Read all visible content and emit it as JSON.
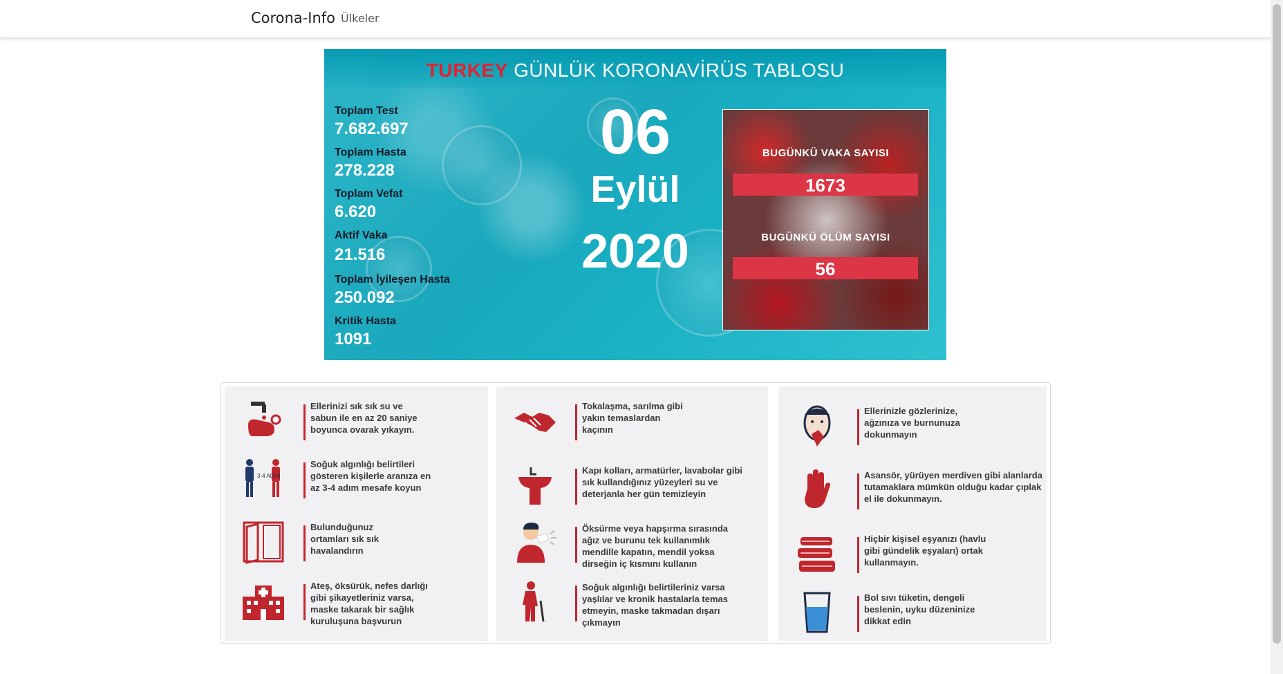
{
  "navbar": {
    "brand": "Corona-Info",
    "link_countries": "Ülkeler"
  },
  "banner": {
    "title_country": "TURKEY",
    "title_rest": "GÜNLÜK KORONAVİRÜS TABLOSU",
    "stats": [
      {
        "label": "Toplam Test",
        "value": "7.682.697"
      },
      {
        "label": "Toplam Hasta",
        "value": "278.228"
      },
      {
        "label": "Toplam Vefat",
        "value": "6.620"
      },
      {
        "label": "Aktif Vaka",
        "value": "21.516"
      },
      {
        "label": "Toplam İyileşen Hasta",
        "value": "250.092"
      },
      {
        "label": "Kritik Hasta",
        "value": "1091"
      }
    ],
    "date": {
      "day": "06",
      "month": "Eylül",
      "year": "2020"
    },
    "today": {
      "cases_label": "BUGÜNKÜ VAKA SAYISI",
      "cases_value": "1673",
      "deaths_label": "BUGÜNKÜ ÖLÜM SAYISI",
      "deaths_value": "56"
    }
  },
  "precautions": {
    "columns": [
      [
        {
          "icon": "handwash-icon",
          "text": "Ellerinizi sık sık su ve sabun ile en az 20 saniye boyunca ovarak yıkayın."
        },
        {
          "icon": "distance-icon",
          "text": "Soğuk algınlığı belirtileri gösteren kişilerle aranıza en az 3-4 adım mesafe koyun",
          "icon_text": "3-4 ADIM"
        },
        {
          "icon": "window-icon",
          "text": "Bulunduğunuz ortamları sık sık havalandırın"
        },
        {
          "icon": "hospital-icon",
          "text": "Ateş, öksürük, nefes darlığı gibi şikayetleriniz varsa, maske takarak bir sağlık kuruluşuna başvurun"
        }
      ],
      [
        {
          "icon": "handshake-icon",
          "text": "Tokalaşma, sarılma gibi yakın temaslardan kaçının"
        },
        {
          "icon": "sink-icon",
          "text": "Kapı kolları, armatürler, lavabolar gibi sık kullandığınız yüzeyleri su ve deterjanla her gün temizleyin"
        },
        {
          "icon": "cough-icon",
          "text": "Öksürme veya hapşırma sırasında ağız ve burunu tek kullanımlık mendille kapatın, mendil yoksa dirseğin iç kısmını kullanın"
        },
        {
          "icon": "elderly-icon",
          "text": "Soğuk algınlığı belirtileriniz varsa yaşlılar ve kronik hastalarla temas etmeyin, maske takmadan dışarı çıkmayın"
        }
      ],
      [
        {
          "icon": "face-touch-icon",
          "text": "Ellerinizle gözlerinize, ağzınıza ve burnunuza dokunmayın"
        },
        {
          "icon": "hand-stop-icon",
          "text": "Asansör, yürüyen merdiven gibi alanlarda tutamaklara mümkün olduğu kadar çıplak el ile dokunmayın."
        },
        {
          "icon": "towels-icon",
          "text": "Hiçbir kişisel eşyanızı (havlu gibi gündelik eşyaları) ortak kullanmayın."
        },
        {
          "icon": "water-glass-icon",
          "text": "Bol sıvı tüketin, dengeli beslenin, uyku düzeninize dikkat edin"
        }
      ]
    ]
  },
  "colors": {
    "accent_red": "#dc3545",
    "banner_teal": "#1aa8bd",
    "icon_red": "#c0262d"
  }
}
